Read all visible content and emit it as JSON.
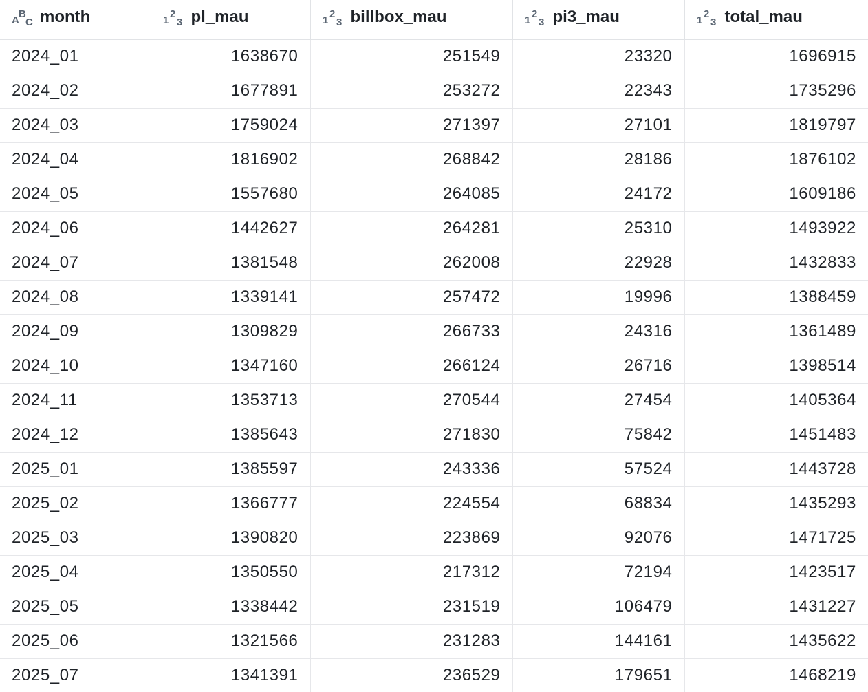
{
  "columns": [
    {
      "key": "month",
      "label": "month",
      "type_icon": "text-type-icon",
      "type_glyph": "ABC"
    },
    {
      "key": "pl_mau",
      "label": "pl_mau",
      "type_icon": "number-type-icon",
      "type_glyph": "123"
    },
    {
      "key": "billbox_mau",
      "label": "billbox_mau",
      "type_icon": "number-type-icon",
      "type_glyph": "123"
    },
    {
      "key": "pi3_mau",
      "label": "pi3_mau",
      "type_icon": "number-type-icon",
      "type_glyph": "123"
    },
    {
      "key": "total_mau",
      "label": "total_mau",
      "type_icon": "number-type-icon",
      "type_glyph": "123"
    }
  ],
  "rows": [
    [
      "2024_01",
      "1638670",
      "251549",
      "23320",
      "1696915"
    ],
    [
      "2024_02",
      "1677891",
      "253272",
      "22343",
      "1735296"
    ],
    [
      "2024_03",
      "1759024",
      "271397",
      "27101",
      "1819797"
    ],
    [
      "2024_04",
      "1816902",
      "268842",
      "28186",
      "1876102"
    ],
    [
      "2024_05",
      "1557680",
      "264085",
      "24172",
      "1609186"
    ],
    [
      "2024_06",
      "1442627",
      "264281",
      "25310",
      "1493922"
    ],
    [
      "2024_07",
      "1381548",
      "262008",
      "22928",
      "1432833"
    ],
    [
      "2024_08",
      "1339141",
      "257472",
      "19996",
      "1388459"
    ],
    [
      "2024_09",
      "1309829",
      "266733",
      "24316",
      "1361489"
    ],
    [
      "2024_10",
      "1347160",
      "266124",
      "26716",
      "1398514"
    ],
    [
      "2024_11",
      "1353713",
      "270544",
      "27454",
      "1405364"
    ],
    [
      "2024_12",
      "1385643",
      "271830",
      "75842",
      "1451483"
    ],
    [
      "2025_01",
      "1385597",
      "243336",
      "57524",
      "1443728"
    ],
    [
      "2025_02",
      "1366777",
      "224554",
      "68834",
      "1435293"
    ],
    [
      "2025_03",
      "1390820",
      "223869",
      "92076",
      "1471725"
    ],
    [
      "2025_04",
      "1350550",
      "217312",
      "72194",
      "1423517"
    ],
    [
      "2025_05",
      "1338442",
      "231519",
      "106479",
      "1431227"
    ],
    [
      "2025_06",
      "1321566",
      "231283",
      "144161",
      "1435622"
    ],
    [
      "2025_07",
      "1341391",
      "236529",
      "179651",
      "1468219"
    ]
  ],
  "colors": {
    "icon": "#5b6673",
    "text": "#1f2328",
    "grid_line": "#e6e7ea"
  }
}
